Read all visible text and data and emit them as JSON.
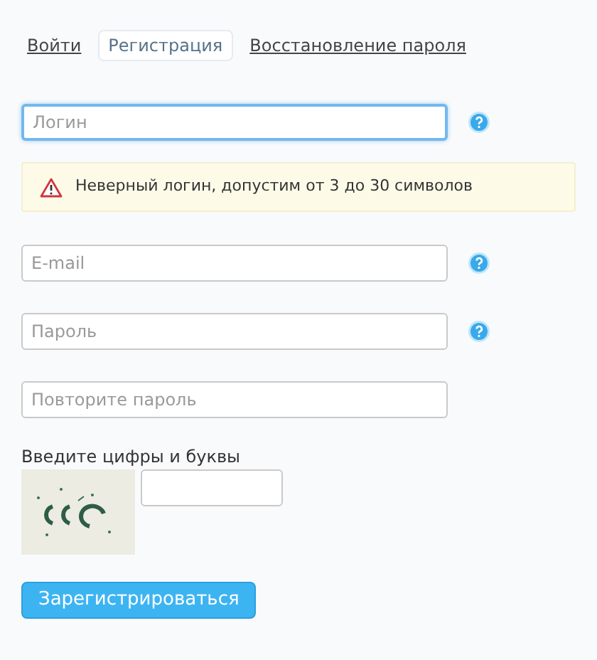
{
  "tabs": [
    {
      "label": "Войти",
      "selected": false
    },
    {
      "label": "Регистрация",
      "selected": true
    },
    {
      "label": "Восстановление пароля",
      "selected": false
    }
  ],
  "fields": [
    {
      "placeholder": "Логин",
      "focused": true,
      "help": true,
      "error": "Неверный логин, допустим от 3 до 30 символов"
    },
    {
      "placeholder": "E-mail",
      "focused": false,
      "help": true
    },
    {
      "placeholder": "Пароль",
      "focused": false,
      "help": true
    },
    {
      "placeholder": "Повторите пароль",
      "focused": false,
      "help": false
    }
  ],
  "captcha": {
    "label": "Введите цифры и буквы"
  },
  "submit_button": "Зарегистрироваться"
}
